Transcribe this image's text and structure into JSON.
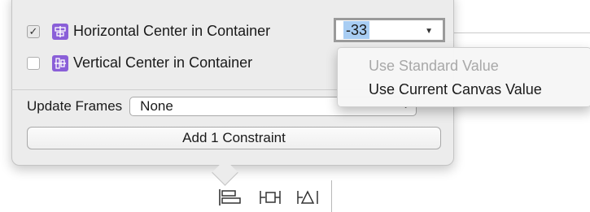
{
  "popover": {
    "horizontal_center": {
      "checked": true,
      "label": "Horizontal Center in Container",
      "icon": "horizontal-center-constraint-icon"
    },
    "vertical_center": {
      "checked": false,
      "label": "Vertical Center in Container",
      "icon": "vertical-center-constraint-icon"
    },
    "constant_field": {
      "value": "-33"
    },
    "update_frames": {
      "label": "Update Frames",
      "selected": "None"
    },
    "add_button_label": "Add 1 Constraint"
  },
  "dropdown_menu": {
    "items": [
      {
        "label": "Use Standard Value",
        "enabled": false
      },
      {
        "label": "Use Current Canvas Value",
        "enabled": true
      }
    ]
  },
  "toolbar": {
    "icons": [
      "align-icon",
      "pin-icon",
      "resolve-issues-icon"
    ]
  },
  "colors": {
    "accent_purple": "#8a5fd8",
    "selection_blue": "#a8cdf3"
  }
}
